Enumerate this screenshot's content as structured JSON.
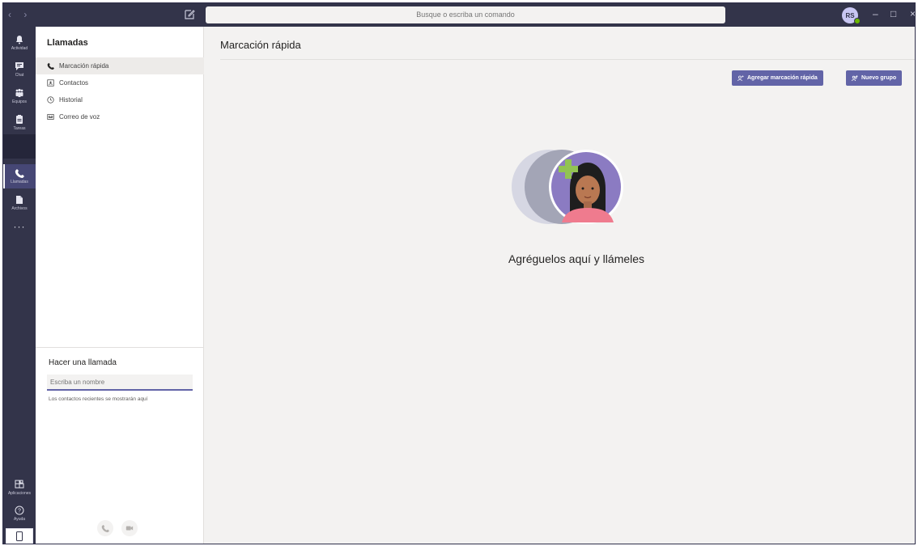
{
  "titlebar": {
    "nav_arrows": "‹ ›",
    "search_placeholder": "Busque o escriba un comando",
    "avatar_initials": "RS",
    "minimize": "–",
    "maximize": "□",
    "close": "×"
  },
  "rail": {
    "items": [
      {
        "label": "Actividad",
        "icon": "bell-icon"
      },
      {
        "label": "Chat",
        "icon": "chat-icon"
      },
      {
        "label": "Equipos",
        "icon": "teams-icon"
      },
      {
        "label": "Tareas",
        "icon": "tasks-icon"
      },
      {
        "label": "Llamadas",
        "icon": "phone-icon",
        "active": true
      },
      {
        "label": "Archivos",
        "icon": "file-icon"
      }
    ],
    "more": "···",
    "apps_label": "Aplicaciones",
    "help_label": "Ayuda"
  },
  "listpane": {
    "title": "Llamadas",
    "items": [
      {
        "label": "Marcación rápida",
        "icon": "phone-icon",
        "active": true
      },
      {
        "label": "Contactos",
        "icon": "contacts-icon"
      },
      {
        "label": "Historial",
        "icon": "clock-icon"
      },
      {
        "label": "Correo de voz",
        "icon": "voicemail-icon"
      }
    ],
    "call": {
      "title": "Hacer una llamada",
      "placeholder": "Escriba un nombre",
      "recent_note": "Los contactos recientes se mostrarán aquí"
    }
  },
  "main": {
    "title": "Marcación rápida",
    "add_speed_dial": "Agregar marcación rápida",
    "new_group": "Nuevo grupo",
    "empty_title": "Agréguelos aquí y llámeles"
  },
  "colors": {
    "rail": "#33344a",
    "accent": "#6264a7",
    "background": "#f3f2f1"
  }
}
